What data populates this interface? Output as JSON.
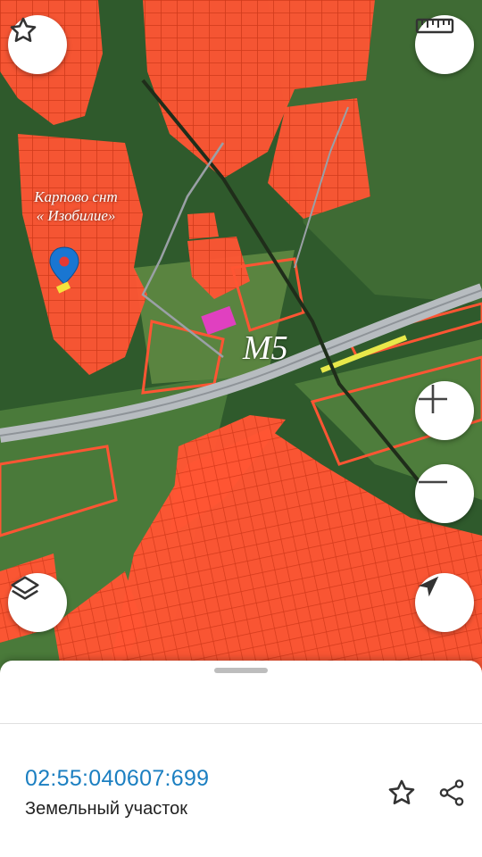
{
  "map": {
    "labels": {
      "settlement_line1": "Карпово снт",
      "settlement_line2": "« Изобилие»",
      "highway": "M5"
    },
    "colors": {
      "parcel_fill": "#ff5533",
      "parcel_stroke": "#d8381a",
      "forest": "#2f5a2c",
      "road": "#9aa0a6",
      "marker": "#1976d2"
    }
  },
  "controls": {
    "favorite_icon": "star-outline-icon",
    "ruler_icon": "ruler-icon",
    "zoom_in_icon": "plus-icon",
    "zoom_out_icon": "minus-icon",
    "layers_icon": "layers-icon",
    "location_icon": "navigation-arrow-icon"
  },
  "sheet": {
    "cadastral_number": "02:55:040607:699",
    "object_type": "Земельный участок",
    "favorite_icon": "star-outline-icon",
    "share_icon": "share-icon"
  }
}
